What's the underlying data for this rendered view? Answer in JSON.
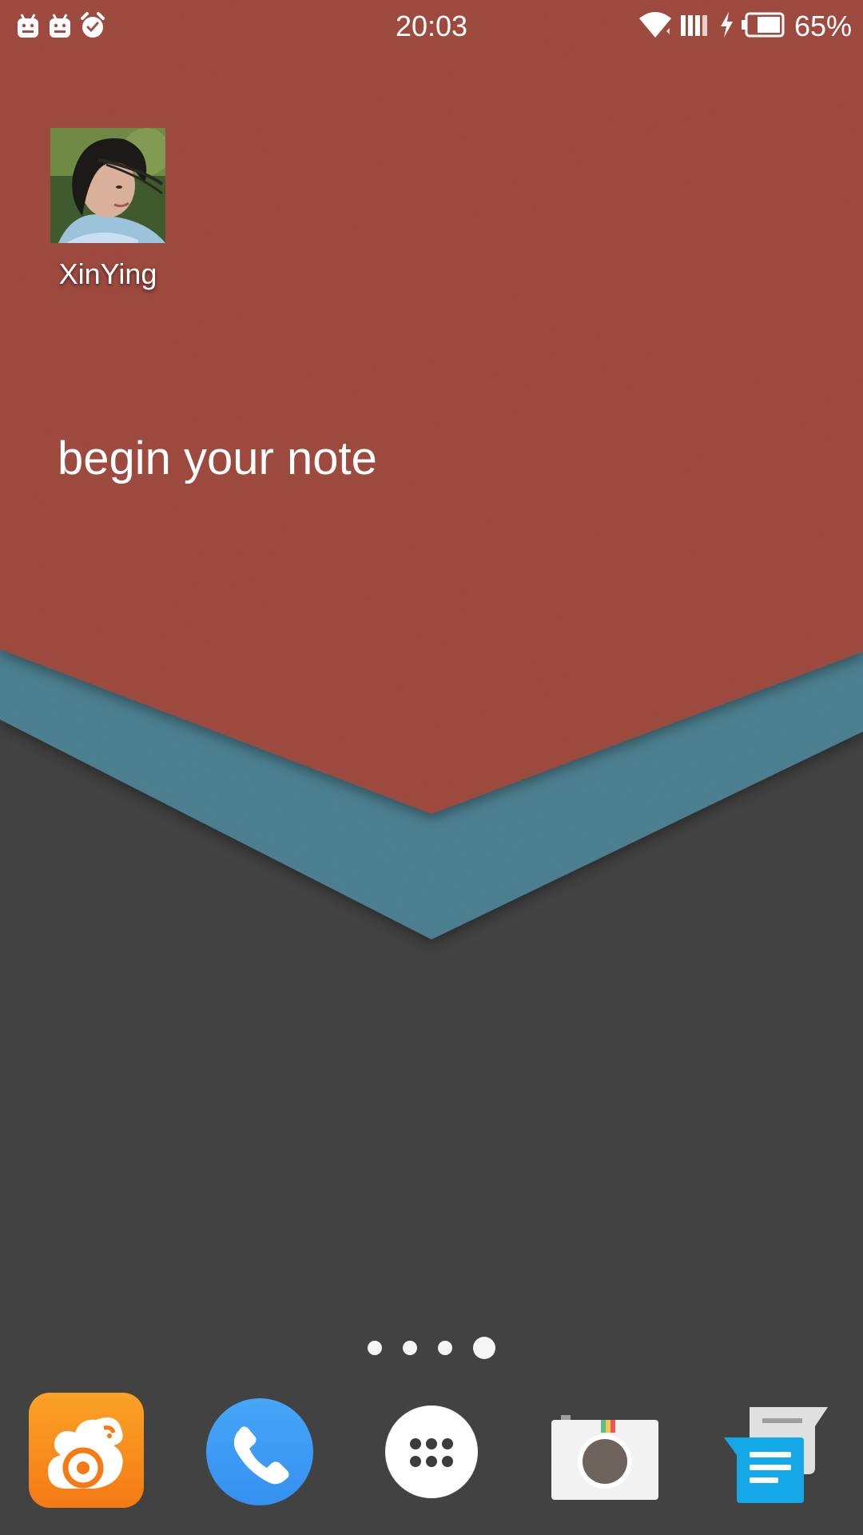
{
  "status_bar": {
    "time": "20:03",
    "battery_percent": "65%",
    "left_icons": [
      "android-notification-icon",
      "android-notification-icon",
      "alarm-icon"
    ],
    "right_icons": [
      "wifi-icon",
      "signal-icon",
      "charging-icon",
      "battery-icon"
    ]
  },
  "home": {
    "contact": {
      "name": "XinYing",
      "icon": "contact-avatar"
    },
    "note_widget": {
      "text": "begin your note"
    },
    "pages": {
      "count": 4,
      "current": 4
    },
    "dock": [
      {
        "icon": "uc-browser-icon"
      },
      {
        "icon": "phone-icon"
      },
      {
        "icon": "app-drawer-icon"
      },
      {
        "icon": "camera-icon"
      },
      {
        "icon": "messages-icon"
      }
    ]
  },
  "colors": {
    "red_panel": "#A44E42",
    "teal_band": "#4F8596",
    "dark_background": "#454545",
    "phone_blue": "#3E9CF5",
    "uc_orange": "#F98E1E",
    "messages_blue": "#16A7E6"
  }
}
